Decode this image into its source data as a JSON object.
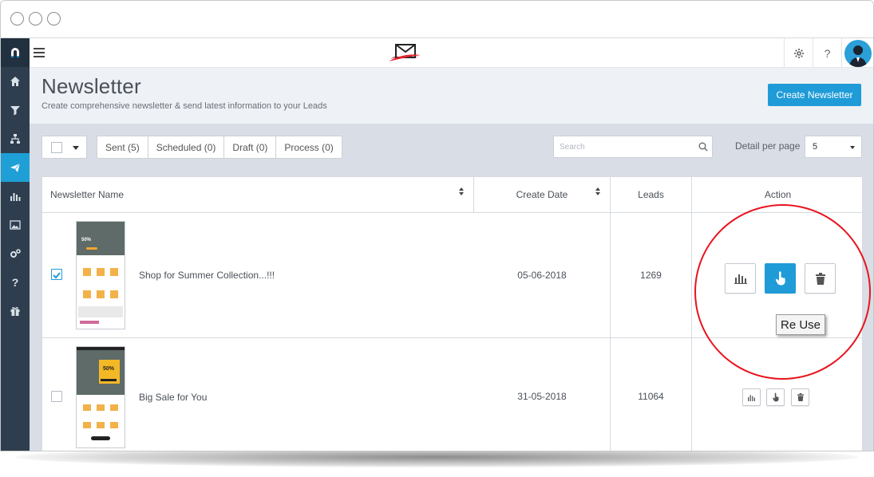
{
  "window": {
    "controls": [
      "close-dot",
      "minimize-dot",
      "maximize-dot"
    ]
  },
  "sidebar": {
    "items": [
      {
        "icon": "home-icon",
        "active": false
      },
      {
        "icon": "funnel-icon",
        "active": false
      },
      {
        "icon": "network-icon",
        "active": false
      },
      {
        "icon": "paper-plane-icon",
        "active": true
      },
      {
        "icon": "bar-chart-icon",
        "active": false
      },
      {
        "icon": "image-icon",
        "active": false
      },
      {
        "icon": "cogs-icon",
        "active": false
      },
      {
        "icon": "help-icon",
        "active": false
      },
      {
        "icon": "gift-icon",
        "active": false
      }
    ]
  },
  "topbar": {
    "settings_icon": "gear-icon",
    "help_label": "?"
  },
  "header": {
    "title": "Newsletter",
    "subtitle": "Create comprehensive newsletter & send latest information to your Leads",
    "create_button": "Create Newsletter"
  },
  "filters": {
    "tabs": [
      {
        "label": "Sent (5)"
      },
      {
        "label": "Scheduled (0)"
      },
      {
        "label": "Draft (0)"
      },
      {
        "label": "Process (0)"
      }
    ]
  },
  "search": {
    "placeholder": "Search",
    "value": ""
  },
  "pagination": {
    "label": "Detail per page",
    "value": "5"
  },
  "table": {
    "columns": {
      "name": "Newsletter Name",
      "date": "Create Date",
      "leads": "Leads",
      "action": "Action"
    },
    "rows": [
      {
        "name": "Shop for Summer Collection...!!!",
        "date": "05-06-2018",
        "leads": "1269",
        "checked": true,
        "thumb_badge": "50%"
      },
      {
        "name": "Big Sale for You",
        "date": "31-05-2018",
        "leads": "11064",
        "checked": false,
        "thumb_badge": "50%"
      }
    ]
  },
  "tooltip": {
    "text": "Re Use"
  },
  "colors": {
    "accent": "#1f9bd7",
    "sidebar": "#2e3e4e",
    "highlight_circle": "#e8141e"
  }
}
